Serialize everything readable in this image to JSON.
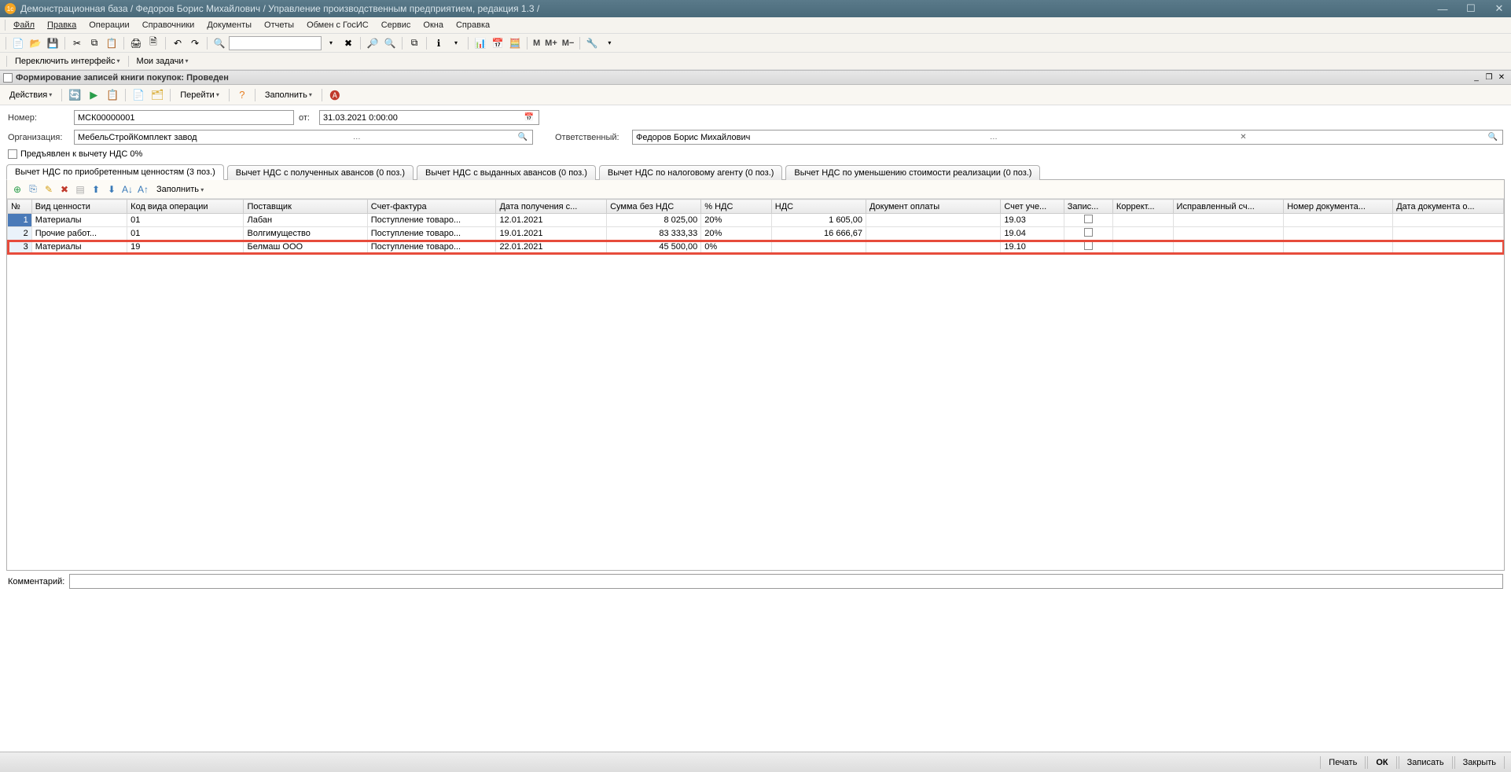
{
  "titlebar": {
    "title": "Демонстрационная база / Федоров Борис Михайлович /  Управление производственным предприятием, редакция 1.3 /"
  },
  "menu": {
    "items": [
      "Файл",
      "Правка",
      "Операции",
      "Справочники",
      "Документы",
      "Отчеты",
      "Обмен с ГосИС",
      "Сервис",
      "Окна",
      "Справка"
    ]
  },
  "subtoolbar": {
    "switch_interface": "Переключить интерфейс",
    "my_tasks": "Мои задачи"
  },
  "docheader": {
    "title": "Формирование записей книги покупок: Проведен"
  },
  "actionbar": {
    "actions": "Действия",
    "goto": "Перейти",
    "fill": "Заполнить"
  },
  "form": {
    "number_label": "Номер:",
    "number_value": "МСК00000001",
    "from_label": "от:",
    "from_value": "31.03.2021  0:00:00",
    "org_label": "Организация:",
    "org_value": "МебельСтройКомплект завод",
    "resp_label": "Ответственный:",
    "resp_value": "Федоров Борис Михайлович",
    "chk_label": "Предъявлен к вычету НДС 0%"
  },
  "tabs": [
    "Вычет НДС по приобретенным ценностям (3 поз.)",
    "Вычет НДС с полученных авансов (0 поз.)",
    "Вычет НДС с выданных авансов (0 поз.)",
    "Вычет НДС по налоговому агенту (0 поз.)",
    "Вычет НДС по уменьшению стоимости реализации (0 поз.)"
  ],
  "rowtoolbar": {
    "fill": "Заполнить"
  },
  "grid": {
    "columns": [
      "№",
      "Вид ценности",
      "Код вида операции",
      "Поставщик",
      "Счет-фактура",
      "Дата получения с...",
      "Сумма без НДС",
      "% НДС",
      "НДС",
      "Документ оплаты",
      "Счет уче...",
      "Запис...",
      "Коррект...",
      "Исправленный сч...",
      "Номер документа...",
      "Дата документа о..."
    ],
    "rows": [
      {
        "n": "1",
        "vid": "Материалы",
        "kod": "01",
        "post": "Лабан",
        "sf": "Поступление товаро...",
        "date": "12.01.2021",
        "sum": "8 025,00",
        "pnds": "20%",
        "nds": "1 605,00",
        "docopl": "",
        "acct": "19.03",
        "zap": "chk"
      },
      {
        "n": "2",
        "vid": "Прочие работ...",
        "kod": "01",
        "post": "Волгимущество",
        "sf": "Поступление товаро...",
        "date": "19.01.2021",
        "sum": "83 333,33",
        "pnds": "20%",
        "nds": "16 666,67",
        "docopl": "",
        "acct": "19.04",
        "zap": "chk"
      },
      {
        "n": "3",
        "vid": "Материалы",
        "kod": "19",
        "post": "Белмаш ООО",
        "sf": "Поступление товаро...",
        "date": "22.01.2021",
        "sum": "45 500,00",
        "pnds": "0%",
        "nds": "",
        "docopl": "",
        "acct": "19.10",
        "zap": "chk",
        "highlight": true
      }
    ]
  },
  "comment": {
    "label": "Комментарий:"
  },
  "footer": {
    "print": "Печать",
    "ok": "ОК",
    "save": "Записать",
    "close": "Закрыть"
  }
}
